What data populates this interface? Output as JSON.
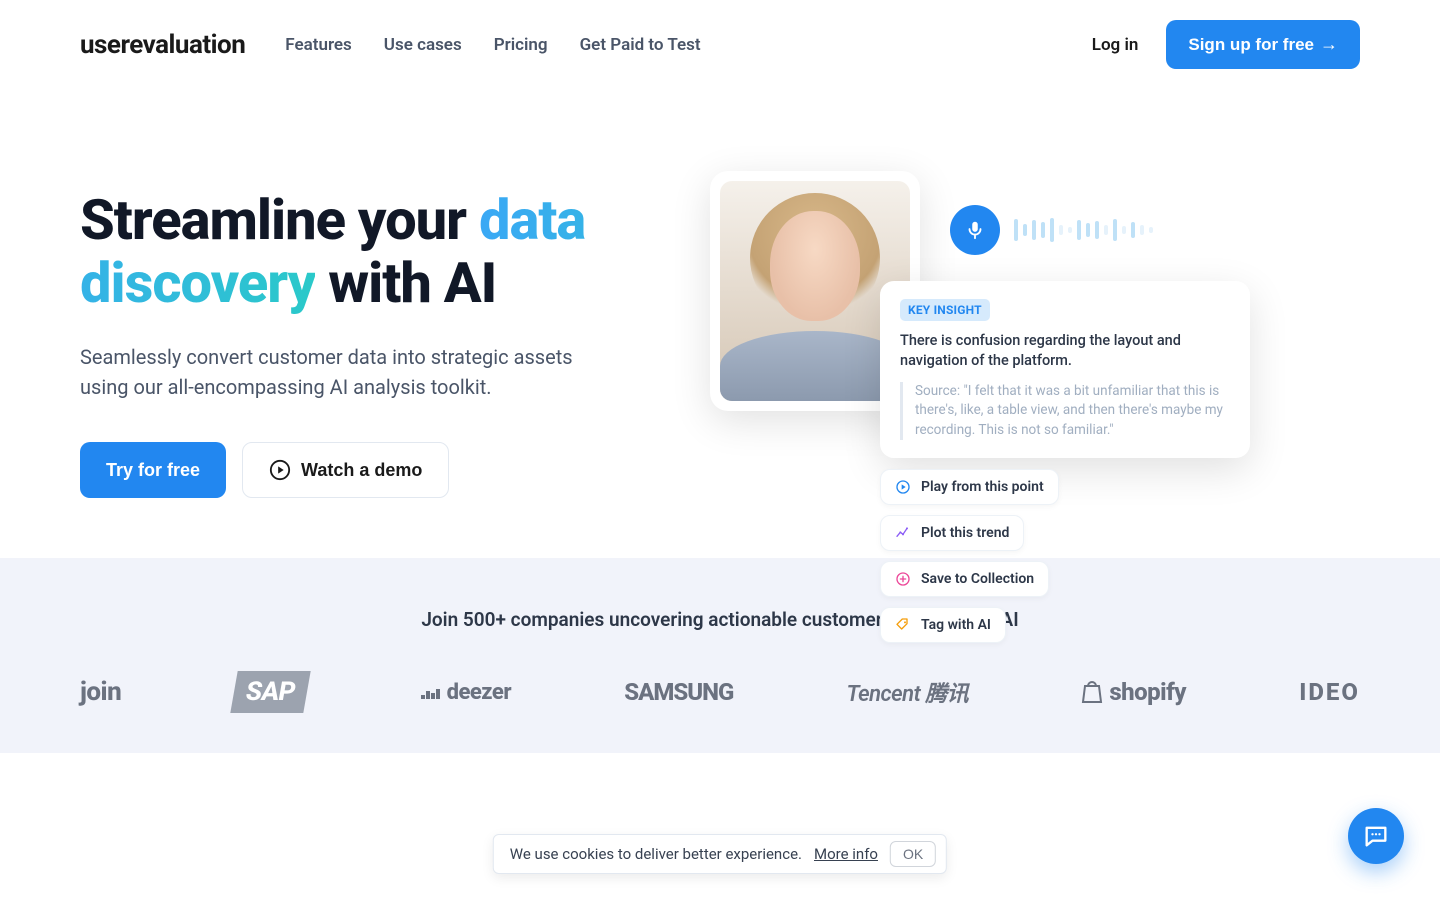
{
  "brand": {
    "name": "userevaluation"
  },
  "nav": {
    "features": "Features",
    "usecases": "Use cases",
    "pricing": "Pricing",
    "getpaid": "Get Paid to Test"
  },
  "header": {
    "login": "Log in",
    "signup": "Sign up for free"
  },
  "hero": {
    "title_prefix": "Streamline your ",
    "title_accent": "data discovery",
    "title_suffix": " with AI",
    "subtitle": "Seamlessly convert customer data into strategic assets using our all-encompassing AI analysis toolkit.",
    "cta_primary": "Try for free",
    "cta_secondary": "Watch a demo"
  },
  "insight": {
    "tag": "KEY INSIGHT",
    "text": "There is confusion regarding the layout and navigation of the platform.",
    "source": "Source: \"I felt that it was a bit unfamiliar that this is there's, like, a table view, and then there's maybe my recording. This is not so familiar.\""
  },
  "chips": {
    "play": "Play from this point",
    "plot": "Plot this trend",
    "save": "Save to Collection",
    "tag": "Tag with AI"
  },
  "social": {
    "title": "Join 500+ companies uncovering actionable customer insights with AI",
    "logos": {
      "join": "join",
      "sap": "SAP",
      "deezer": "deezer",
      "samsung": "SAMSUNG",
      "tencent": "Tencent 腾讯",
      "shopify": "shopify",
      "ideo": "IDEO"
    }
  },
  "cookie": {
    "text": "We use cookies to deliver better experience.",
    "more": "More info",
    "ok": "OK"
  }
}
